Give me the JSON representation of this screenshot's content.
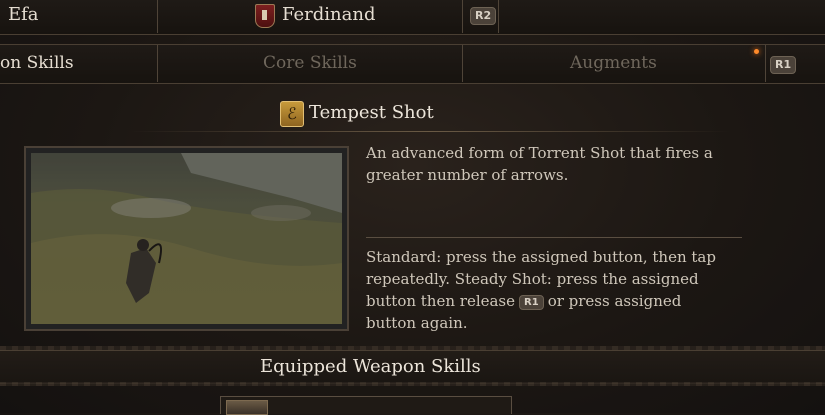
{
  "party_bar": {
    "left_name": "Efa",
    "active_name": "Ferdinand",
    "next_button": "R2"
  },
  "tabs": {
    "items": [
      "on Skills",
      "Core Skills",
      "Augments"
    ],
    "next_button": "R1"
  },
  "skill": {
    "icon_glyph": "ℰ",
    "name": "Tempest Shot",
    "description": "An advanced form of Torrent Shot that fires a greater number of arrows.",
    "controls_part1": "Standard: press the assigned button, then tap repeatedly. Steady Shot: press the assigned button then release",
    "controls_button": "R1",
    "controls_part2": "or press assigned button again."
  },
  "section": {
    "title": "Equipped Weapon Skills"
  },
  "colors": {
    "accent_gold": "#c79a3b",
    "crest_red": "#7c1f1f",
    "text": "#d9d2c6"
  }
}
